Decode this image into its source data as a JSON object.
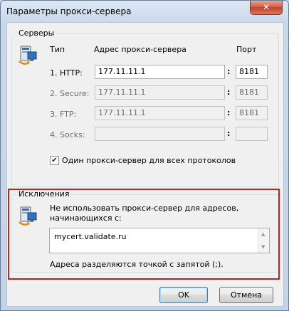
{
  "window": {
    "title": "Параметры прокси-сервера",
    "close_glyph": "✕"
  },
  "servers": {
    "group_label": "Серверы",
    "col_type": "Тип",
    "col_address": "Адрес прокси-сервера",
    "col_port": "Порт",
    "rows": [
      {
        "label": "1. HTTP:",
        "address": "177.11.11.1",
        "port": "8181",
        "enabled": true
      },
      {
        "label": "2. Secure:",
        "address": "177.11.11.1",
        "port": "8181",
        "enabled": false
      },
      {
        "label": "3. FTP:",
        "address": "177.11.11.1",
        "port": "8181",
        "enabled": false
      },
      {
        "label": "4. Socks:",
        "address": "",
        "port": "",
        "enabled": false
      }
    ],
    "colon": ":",
    "same_proxy_label": "Один прокси-сервер для всех протоколов",
    "same_proxy_checked": true
  },
  "exceptions": {
    "group_label": "Исключения",
    "description_line1": "Не использовать прокси-сервер для адресов,",
    "description_line2": "начинающихся с:",
    "value": "mycert.validate.ru",
    "hint": "Адреса разделяются точкой с запятой (;)."
  },
  "buttons": {
    "ok": "OK",
    "cancel": "Отмена"
  },
  "colors": {
    "highlight": "#d01c1c",
    "title_bar": "#c9d8ea",
    "close_button": "#c5412a"
  },
  "icons": {
    "servers": "network-computer-icon",
    "exceptions": "network-computer-icon",
    "close": "close-icon"
  }
}
